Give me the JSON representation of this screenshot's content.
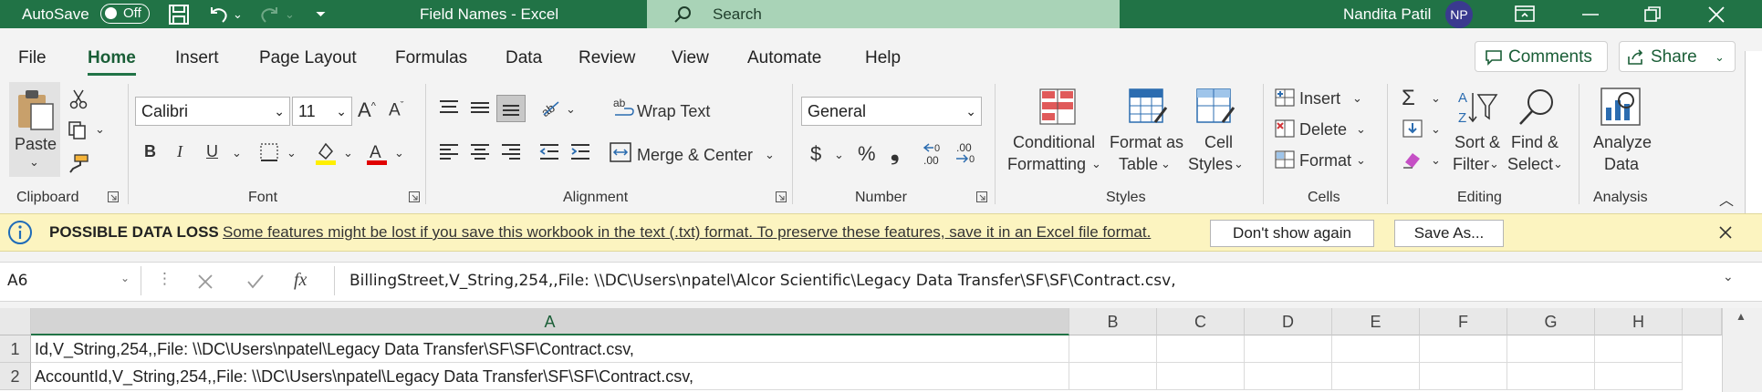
{
  "titlebar": {
    "autosave_label": "AutoSave",
    "autosave_state": "Off",
    "title": "Field Names  -  Excel",
    "search_placeholder": "Search",
    "user_name": "Nandita Patil",
    "user_initials": "NP"
  },
  "tabs": [
    "File",
    "Home",
    "Insert",
    "Page Layout",
    "Formulas",
    "Data",
    "Review",
    "View",
    "Automate",
    "Help"
  ],
  "active_tab": "Home",
  "comments_label": "Comments",
  "share_label": "Share",
  "ribbon": {
    "clipboard": {
      "paste": "Paste",
      "group": "Clipboard"
    },
    "font": {
      "name": "Calibri",
      "size": "11",
      "group": "Font",
      "bold": "B",
      "italic": "I",
      "underline": "U"
    },
    "alignment": {
      "wrap": "Wrap Text",
      "merge": "Merge & Center",
      "group": "Alignment"
    },
    "number": {
      "format": "General",
      "currency": "$",
      "percent": "%",
      "comma": "❟",
      "group": "Number"
    },
    "styles": {
      "conditional_1": "Conditional",
      "conditional_2": "Formatting",
      "format_table_1": "Format as",
      "format_table_2": "Table",
      "cell_styles_1": "Cell",
      "cell_styles_2": "Styles",
      "group": "Styles"
    },
    "cells": {
      "insert": "Insert",
      "delete": "Delete",
      "format": "Format",
      "group": "Cells"
    },
    "editing": {
      "sort_1": "Sort &",
      "sort_2": "Filter",
      "find_1": "Find &",
      "find_2": "Select",
      "group": "Editing"
    },
    "analysis": {
      "analyze_1": "Analyze",
      "analyze_2": "Data",
      "group": "Analysis"
    }
  },
  "banner": {
    "title": "POSSIBLE DATA LOSS",
    "message": "Some features might be lost if you save this workbook in the text (.txt) format. To preserve these features, save it in an Excel file format.",
    "dont_show": "Don't show again",
    "save_as": "Save As..."
  },
  "formula_bar": {
    "name_box": "A6",
    "fx": "fx",
    "content": "BillingStreet,V_String,254,,File: \\\\DC\\Users\\npatel\\Alcor Scientific\\Legacy Data Transfer\\SF\\SF\\Contract.csv,"
  },
  "grid": {
    "columns": [
      "A",
      "B",
      "C",
      "D",
      "E",
      "F",
      "G",
      "H"
    ],
    "rows": [
      {
        "num": "1",
        "a": "Id,V_String,254,,File: \\\\DC\\Users\\npatel\\Legacy Data Transfer\\SF\\SF\\Contract.csv,"
      },
      {
        "num": "2",
        "a": "AccountId,V_String,254,,File: \\\\DC\\Users\\npatel\\Legacy Data Transfer\\SF\\SF\\Contract.csv,"
      }
    ]
  },
  "colors": {
    "excel_green": "#217346",
    "banner_bg": "#fcf4c0"
  }
}
